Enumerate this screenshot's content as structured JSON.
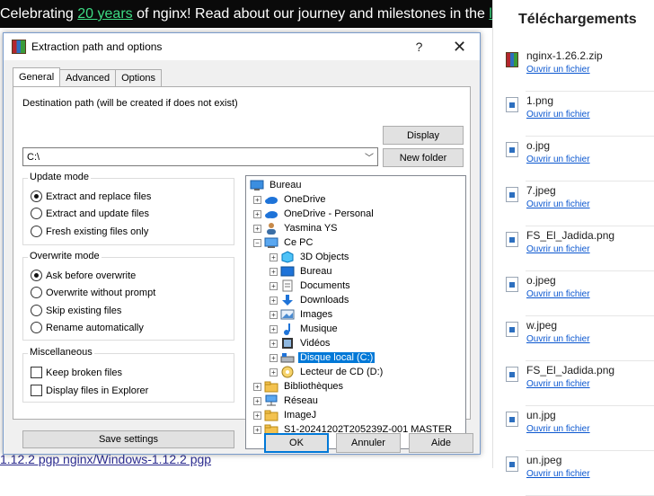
{
  "web": {
    "banner_prefix": "Celebrating ",
    "banner_link": "20 years",
    "banner_suffix": " of nginx! Read about our journey and milestones in the ",
    "banner_link2": "la",
    "bottom_text": "1.12.2  pgp     nginx/Windows-1.12.2  pgp"
  },
  "dialog": {
    "title": "Extraction path and options",
    "help_label": "?",
    "close_label": "✕",
    "tabs": [
      "General",
      "Advanced",
      "Options"
    ],
    "dest_label": "Destination path (will be created if does not exist)",
    "dest_value": "C:\\",
    "display_button": "Display",
    "new_folder_button": "New folder",
    "update_mode": {
      "title": "Update mode",
      "options": [
        "Extract and replace files",
        "Extract and update files",
        "Fresh existing files only"
      ],
      "selected": 0
    },
    "overwrite_mode": {
      "title": "Overwrite mode",
      "options": [
        "Ask before overwrite",
        "Overwrite without prompt",
        "Skip existing files",
        "Rename automatically"
      ],
      "selected": 0
    },
    "misc": {
      "title": "Miscellaneous",
      "options": [
        "Keep broken files",
        "Display files in Explorer"
      ]
    },
    "save_settings": "Save settings",
    "ok": "OK",
    "cancel": "Annuler",
    "help": "Aide",
    "tree": [
      {
        "label": "Bureau",
        "icon": "desktop-icon"
      },
      {
        "label": "OneDrive",
        "icon": "cloud-icon"
      },
      {
        "label": "OneDrive - Personal",
        "icon": "cloud-icon"
      },
      {
        "label": "Yasmina YS",
        "icon": "user-icon"
      },
      {
        "label": "Ce PC",
        "icon": "computer-icon"
      },
      {
        "label": "3D Objects",
        "icon": "cube-icon"
      },
      {
        "label": "Bureau",
        "icon": "desktop-icon"
      },
      {
        "label": "Documents",
        "icon": "document-icon"
      },
      {
        "label": "Downloads",
        "icon": "download-icon"
      },
      {
        "label": "Images",
        "icon": "image-icon"
      },
      {
        "label": "Musique",
        "icon": "music-icon"
      },
      {
        "label": "Vidéos",
        "icon": "video-icon"
      },
      {
        "label": "Disque local (C:)",
        "icon": "drive-icon"
      },
      {
        "label": "Lecteur de CD (D:)",
        "icon": "cd-icon"
      },
      {
        "label": "Bibliothèques",
        "icon": "library-icon"
      },
      {
        "label": "Réseau",
        "icon": "network-icon"
      },
      {
        "label": "ImageJ",
        "icon": "folder-icon"
      },
      {
        "label": "S1-20241202T205239Z-001 MASTER",
        "icon": "folder-icon"
      }
    ]
  },
  "downloads": {
    "title": "Téléchargements",
    "open_label": "Ouvrir un fichier",
    "items": [
      "nginx-1.26.2.zip",
      "1.png",
      "o.jpg",
      "7.jpeg",
      "FS_El_Jadida.png",
      "o.jpeg",
      "w.jpeg",
      "FS_El_Jadida.png",
      "un.jpg",
      "un.jpeg"
    ]
  },
  "colors": {
    "accent": "#0078d7",
    "link": "#0b57d0",
    "banner_link": "#3ddc84"
  }
}
